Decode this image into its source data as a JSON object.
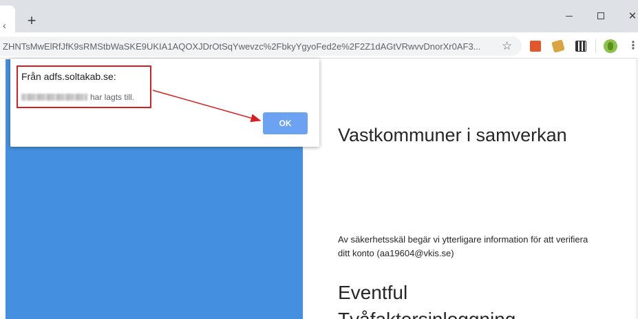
{
  "browser": {
    "new_tab": "+",
    "tab_left_glyph": "‹",
    "close_glyph": "✕",
    "address_url": "ZHNTsMwElRfJfK9sRMStbWaSKE9UKIA1AQOXJDrOtSqYwevzc%2FbkyYgyoFed2e%2F2Z1dAGtVRwvvDnorXr0AF3...",
    "star_glyph": "☆",
    "menu_glyph": "⋮"
  },
  "dialog": {
    "title": "Från adfs.soltakab.se:",
    "message_suffix": "har lagts till.",
    "ok_label": "OK"
  },
  "page": {
    "org_name": "Vastkommuner i samverkan",
    "info_text": "Av säkerhetsskäl begär vi ytterligare information för att verifiera ditt konto (aa19604@vkis.se)",
    "method_title": "Eventful",
    "method_subtitle": "Tvåfaktorsinloggning"
  },
  "colors": {
    "panel_blue": "#458fe0",
    "ok_blue": "#6ba2f2",
    "annotation_red": "#d81e1e"
  }
}
